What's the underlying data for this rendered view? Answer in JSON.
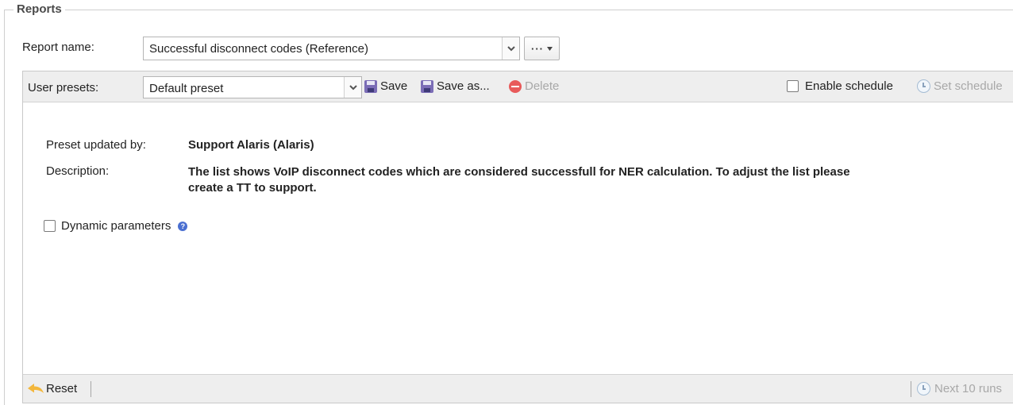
{
  "fieldset": {
    "legend": "Reports"
  },
  "report": {
    "label": "Report name:",
    "selected": "Successful disconnect codes (Reference)",
    "more_button": "···"
  },
  "toolbar": {
    "presets_label": "User presets:",
    "preset_selected": "Default preset",
    "save_label": "Save",
    "save_as_label": "Save as...",
    "delete_label": "Delete",
    "enable_schedule_label": "Enable schedule",
    "set_schedule_label": "Set schedule"
  },
  "details": {
    "updated_by_label": "Preset updated by:",
    "updated_by_value": "Support Alaris (Alaris)",
    "description_label": "Description:",
    "description_line1": "The list shows VoIP disconnect codes which are considered successfull for NER calculation. To adjust the list please",
    "description_line2": "create a TT to support."
  },
  "dynamic": {
    "label": "Dynamic parameters",
    "help": "?"
  },
  "footer": {
    "reset_label": "Reset",
    "next_runs_label": "Next 10 runs"
  },
  "icons": {
    "combo_arrow": "chevron-down-icon",
    "save": "floppy-disk-icon",
    "save_as": "floppy-disk-icon",
    "delete": "delete-icon",
    "set_schedule": "clock-icon",
    "help": "help-icon",
    "reset": "undo-arrow-icon",
    "next_runs": "clock-icon"
  },
  "colors": {
    "toolbar_bg": "#eeeeee",
    "help": "#4a6fd1",
    "delete": "#e85a5a",
    "reset_arrow": "#f3b73c",
    "disabled_text": "#a8a8a8"
  }
}
